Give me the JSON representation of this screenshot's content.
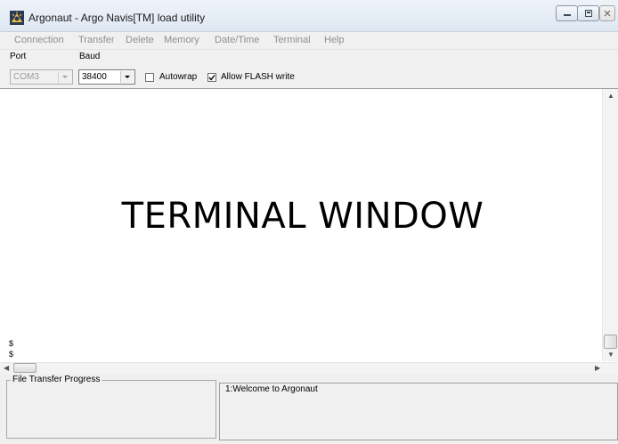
{
  "window": {
    "title": "Argonaut - Argo Navis[TM] load utility"
  },
  "menu": [
    "Connection",
    "Transfer",
    "Delete",
    "Memory",
    "Date/Time",
    "Terminal",
    "Help"
  ],
  "toolbar": {
    "port_label": "Port",
    "port_value": "COM3",
    "baud_label": "Baud",
    "baud_value": "38400",
    "autowrap_label": "Autowrap",
    "autowrap_checked": false,
    "flash_label": "Allow FLASH write",
    "flash_checked": true
  },
  "terminal": {
    "overlay_text": "TERMINAL WINDOW",
    "lines": [
      "$",
      "$"
    ]
  },
  "progress": {
    "label": "File Transfer Progress"
  },
  "status": {
    "message": "1:Welcome to Argonaut"
  }
}
